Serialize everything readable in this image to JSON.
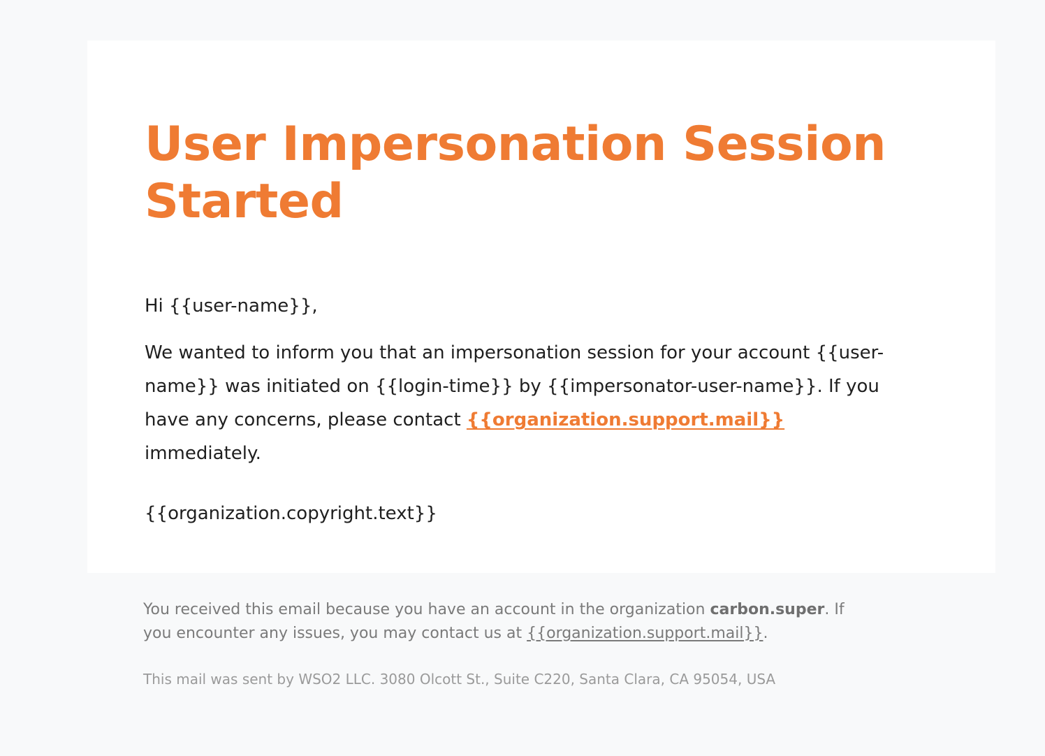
{
  "email": {
    "title": "User Impersonation Session Started",
    "greeting": "Hi {{user-name}},",
    "body": {
      "line1": "We wanted to inform you that an impersonation session for your account {{user-",
      "line2": "name}} was initiated on {{login-time}} by {{impersonator-user-name}}. If you",
      "line3_prefix": "have any concerns, please contact ",
      "support_link": "{{organization.support.mail}}",
      "line4": "immediately."
    },
    "copyright": "{{organization.copyright.text}}"
  },
  "footer": {
    "line1_prefix": "You received this email because you have an account in the organization ",
    "organization": "carbon.super",
    "line1_suffix": ". If",
    "line2_prefix": "you encounter any issues, you may contact us at ",
    "support_link": "{{organization.support.mail}}",
    "line2_suffix": ".",
    "address": "This mail was sent by WSO2 LLC. 3080 Olcott St., Suite C220, Santa Clara, CA 95054, USA"
  },
  "colors": {
    "accent": "#ef7b33",
    "page_background": "#f8f9fa",
    "card_background": "#ffffff",
    "body_text": "#1f1f1f",
    "footer_text": "#7a7a7a"
  }
}
